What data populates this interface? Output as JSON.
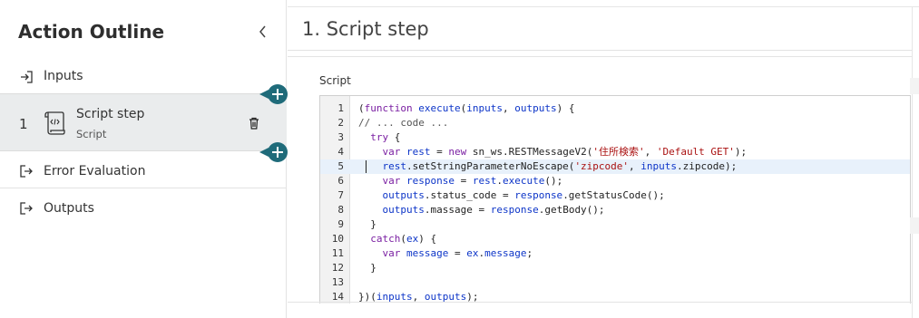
{
  "sidebar": {
    "title": "Action Outline",
    "items": [
      {
        "label": "Inputs",
        "icon": "arrow-into-bracket-icon"
      },
      {
        "label": "Error Evaluation",
        "icon": "arrow-out-bracket-icon"
      },
      {
        "label": "Outputs",
        "icon": "arrow-out-bracket-icon"
      }
    ],
    "step": {
      "number": "1",
      "title": "Script step",
      "subtitle": "Script",
      "icon": "script-scroll-icon"
    }
  },
  "main": {
    "page_title": "1.  Script step",
    "script_label": "Script"
  },
  "editor": {
    "active_line": 5,
    "lines": [
      {
        "n": "1",
        "code": "(function execute(inputs, outputs) {"
      },
      {
        "n": "2",
        "code": "// ... code ..."
      },
      {
        "n": "3",
        "code": "  try {"
      },
      {
        "n": "4",
        "code": "    var rest = new sn_ws.RESTMessageV2('住所検索', 'Default GET');"
      },
      {
        "n": "5",
        "code": "    rest.setStringParameterNoEscape('zipcode', inputs.zipcode);"
      },
      {
        "n": "6",
        "code": "    var response = rest.execute();"
      },
      {
        "n": "7",
        "code": "    outputs.status_code = response.getStatusCode();"
      },
      {
        "n": "8",
        "code": "    outputs.massage = response.getBody();"
      },
      {
        "n": "9",
        "code": "  }"
      },
      {
        "n": "10",
        "code": "  catch(ex) {"
      },
      {
        "n": "11",
        "code": "    var message = ex.message;"
      },
      {
        "n": "12",
        "code": "  }"
      },
      {
        "n": "13",
        "code": ""
      },
      {
        "n": "14",
        "code": "})(inputs, outputs);"
      }
    ]
  }
}
